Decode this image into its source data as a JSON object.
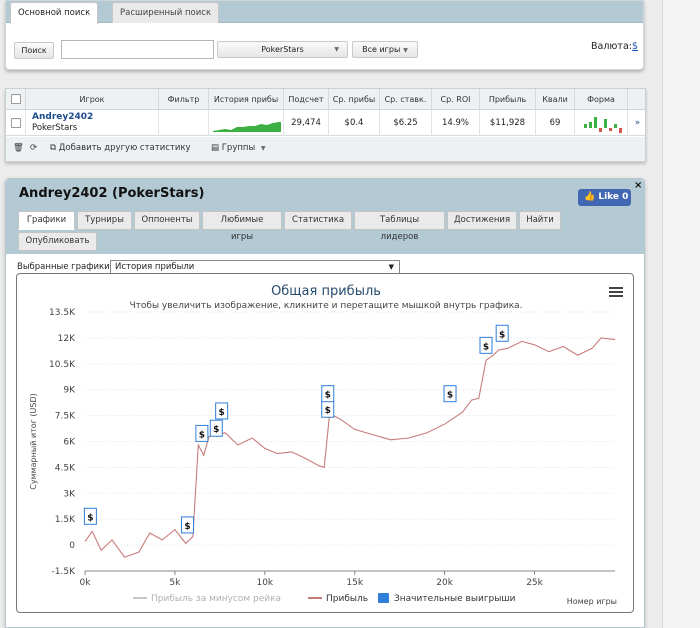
{
  "search": {
    "tabs": [
      "Основной поиск",
      "Расширенный поиск"
    ],
    "search_button": "Поиск",
    "input_value": "",
    "site_select": "PokerStars",
    "games_select": "Все игры",
    "currency_label": "Валюта:",
    "currency_value": "$"
  },
  "table": {
    "headers": [
      "Игрок",
      "Фильтр",
      "История прибы",
      "Подсчет",
      "Ср. прибы",
      "Ср. ставк.",
      "Ср. ROI",
      "Прибыль",
      "Квали",
      "Форма"
    ],
    "row": {
      "player_name": "Andrey2402",
      "site": "PokerStars",
      "count": "29,474",
      "avg_profit": "$0.4",
      "avg_stake": "$6.25",
      "avg_roi": "14.9%",
      "profit": "$11,928",
      "qual": "69",
      "link": "»"
    },
    "footer": {
      "add_stats": "Добавить другую статистику",
      "groups": "Группы"
    }
  },
  "player": {
    "title": "Andrey2402 (PokerStars)",
    "like_label": "Like 0",
    "close_label": "×",
    "tabs": [
      "Графики",
      "Турниры",
      "Оппоненты",
      "Любимые игры",
      "Статистика",
      "Таблицы лидеров",
      "Достижения",
      "Найти",
      "Опубликовать"
    ],
    "graph_select_label": "Выбранные графики:",
    "graph_select_value": "История прибыли"
  },
  "colors": {
    "header_bg": "#b3c9d3",
    "profit_line": "#c97b7b",
    "rake_line": "#c8c8c8",
    "marker_blue": "#2f7ed8",
    "link_blue": "#1e4c8f",
    "like_blue": "#4267b2"
  },
  "chart_data": {
    "type": "line",
    "title": "Общая прибыль",
    "subtitle": "Чтобы увеличить изображение, кликните и перетащите мышкой внутрь графика.",
    "ylabel": "Суммарный итог (USD)",
    "xlabel": "Номер игры",
    "ylim": [
      -1500,
      13500
    ],
    "xlim": [
      0,
      29474
    ],
    "y_ticks": [
      "-1.5K",
      "0",
      "1.5K",
      "3K",
      "4.5K",
      "6K",
      "7.5K",
      "9K",
      "10.5K",
      "12K",
      "13.5K"
    ],
    "x_ticks": [
      "0k",
      "5k",
      "10k",
      "15k",
      "20k",
      "25k"
    ],
    "grid": true,
    "legend": [
      "Прибыль за минусом рейка",
      "Прибыль",
      "Значительные выигрыши"
    ],
    "legend_position": "bottom",
    "series": [
      {
        "name": "Прибыль",
        "x": [
          0,
          400,
          900,
          1500,
          2200,
          3000,
          3600,
          4300,
          5000,
          5600,
          6000,
          6300,
          6600,
          6900,
          7300,
          7800,
          8500,
          9300,
          10000,
          10700,
          11500,
          12300,
          13000,
          13300,
          13600,
          14200,
          15000,
          16000,
          17000,
          18000,
          19000,
          20000,
          21000,
          21500,
          21900,
          22300,
          22700,
          23000,
          23500,
          24300,
          25000,
          25800,
          26600,
          27400,
          28200,
          28700,
          29474
        ],
        "values": [
          200,
          800,
          -300,
          300,
          -700,
          -400,
          700,
          300,
          900,
          100,
          500,
          5800,
          5200,
          6300,
          6400,
          6500,
          5800,
          6200,
          5600,
          5300,
          5400,
          5000,
          4600,
          4500,
          7600,
          7300,
          6700,
          6400,
          6100,
          6200,
          6500,
          7000,
          7700,
          8400,
          8500,
          10700,
          11000,
          11300,
          11400,
          11800,
          11600,
          11200,
          11500,
          11000,
          11400,
          12000,
          11900
        ]
      }
    ],
    "big_wins": [
      {
        "x": 300,
        "y": 800,
        "label": "$"
      },
      {
        "x": 5700,
        "y": 300,
        "label": "$"
      },
      {
        "x": 6500,
        "y": 5600,
        "label": "$"
      },
      {
        "x": 7300,
        "y": 5900,
        "label": "$"
      },
      {
        "x": 7600,
        "y": 6900,
        "label": "$"
      },
      {
        "x": 13500,
        "y": 7000,
        "label": "$"
      },
      {
        "x": 13500,
        "y": 7900,
        "label": "$"
      },
      {
        "x": 20300,
        "y": 7900,
        "label": "$"
      },
      {
        "x": 22300,
        "y": 10700,
        "label": "$"
      },
      {
        "x": 23200,
        "y": 11400,
        "label": "$"
      }
    ]
  }
}
